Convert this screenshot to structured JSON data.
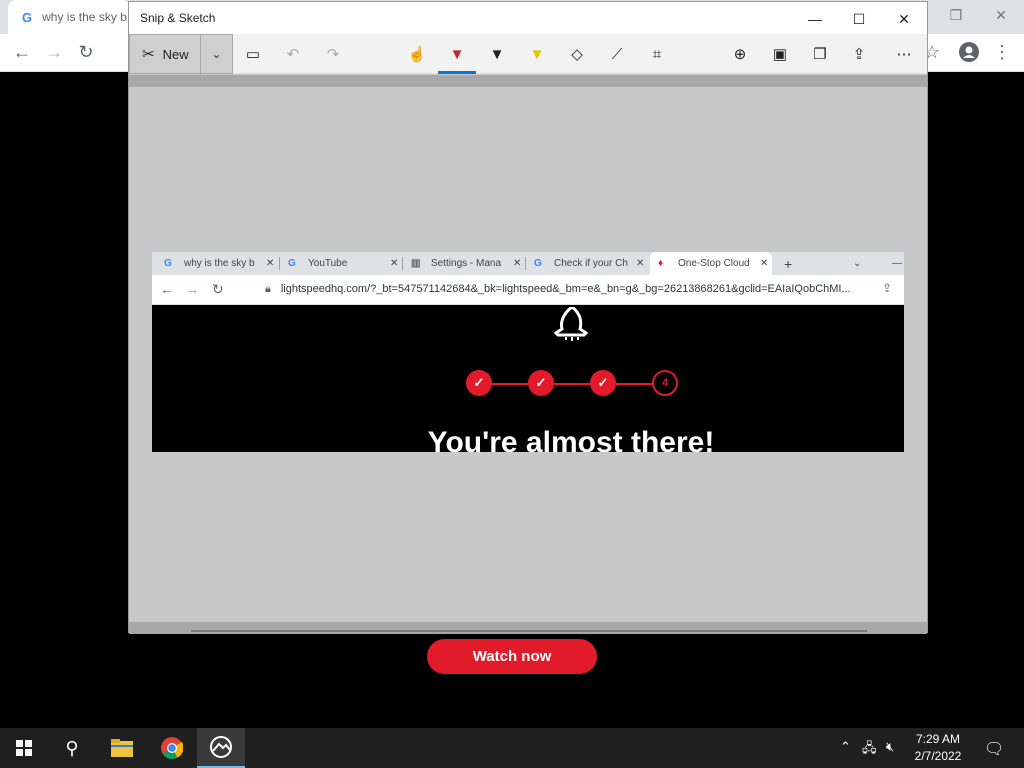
{
  "background_browser": {
    "tab_title": "why is the sky b",
    "watch_now_label": "Watch now"
  },
  "snip_window": {
    "title": "Snip & Sketch",
    "new_label": "New"
  },
  "capture": {
    "tabs": [
      {
        "icon": "G",
        "title": "why is the sky b"
      },
      {
        "icon": "G",
        "title": "YouTube"
      },
      {
        "icon": "▥",
        "title": "Settings - Mana"
      },
      {
        "icon": "G",
        "title": "Check if your Ch"
      },
      {
        "icon": "♦",
        "title": "One-Stop Cloud"
      }
    ],
    "url": "lightspeedhq.com/?_bt=547571142684&_bk=lightspeed&_bm=e&_bn=g&_bg=26213868261&gclid=EAIaIQobChMI...",
    "steps": [
      "✓",
      "✓",
      "✓",
      "4"
    ],
    "headline": "You're almost there!"
  },
  "taskbar": {
    "time": "7:29 AM",
    "date": "2/7/2022"
  }
}
